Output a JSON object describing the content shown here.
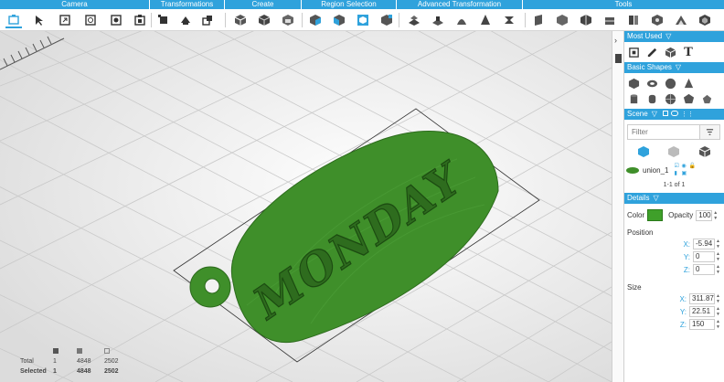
{
  "toolbar": {
    "groups": [
      "Camera",
      "Transformations",
      "Create",
      "Region Selection",
      "Advanced Transformation",
      "Tools"
    ]
  },
  "viewport": {
    "model_text": "MONDAY",
    "model_color": "#3f8f2a"
  },
  "stats": {
    "total_label": "Total",
    "selected_label": "Selected",
    "total": [
      "1",
      "4848",
      "2502"
    ],
    "selected": [
      "1",
      "4848",
      "2502"
    ]
  },
  "panel": {
    "most_used": "Most Used",
    "basic_shapes": "Basic Shapes",
    "scene": "Scene",
    "filter_placeholder": "Filter",
    "object_name": "union_1",
    "pager": "1-1 of 1",
    "details": "Details",
    "color_label": "Color",
    "color_value": "#3fa02a",
    "opacity_label": "Opacity",
    "opacity_value": "100",
    "position_label": "Position",
    "position": {
      "x": "-5.94",
      "y": "0",
      "z": "0"
    },
    "size_label": "Size",
    "size": {
      "x": "311.87",
      "y": "22.51",
      "z": "150"
    },
    "axis_x": "X:",
    "axis_y": "Y:",
    "axis_z": "Z:"
  },
  "colors": {
    "accent": "#2fa2dc",
    "model_green": "#3f8f2a"
  }
}
